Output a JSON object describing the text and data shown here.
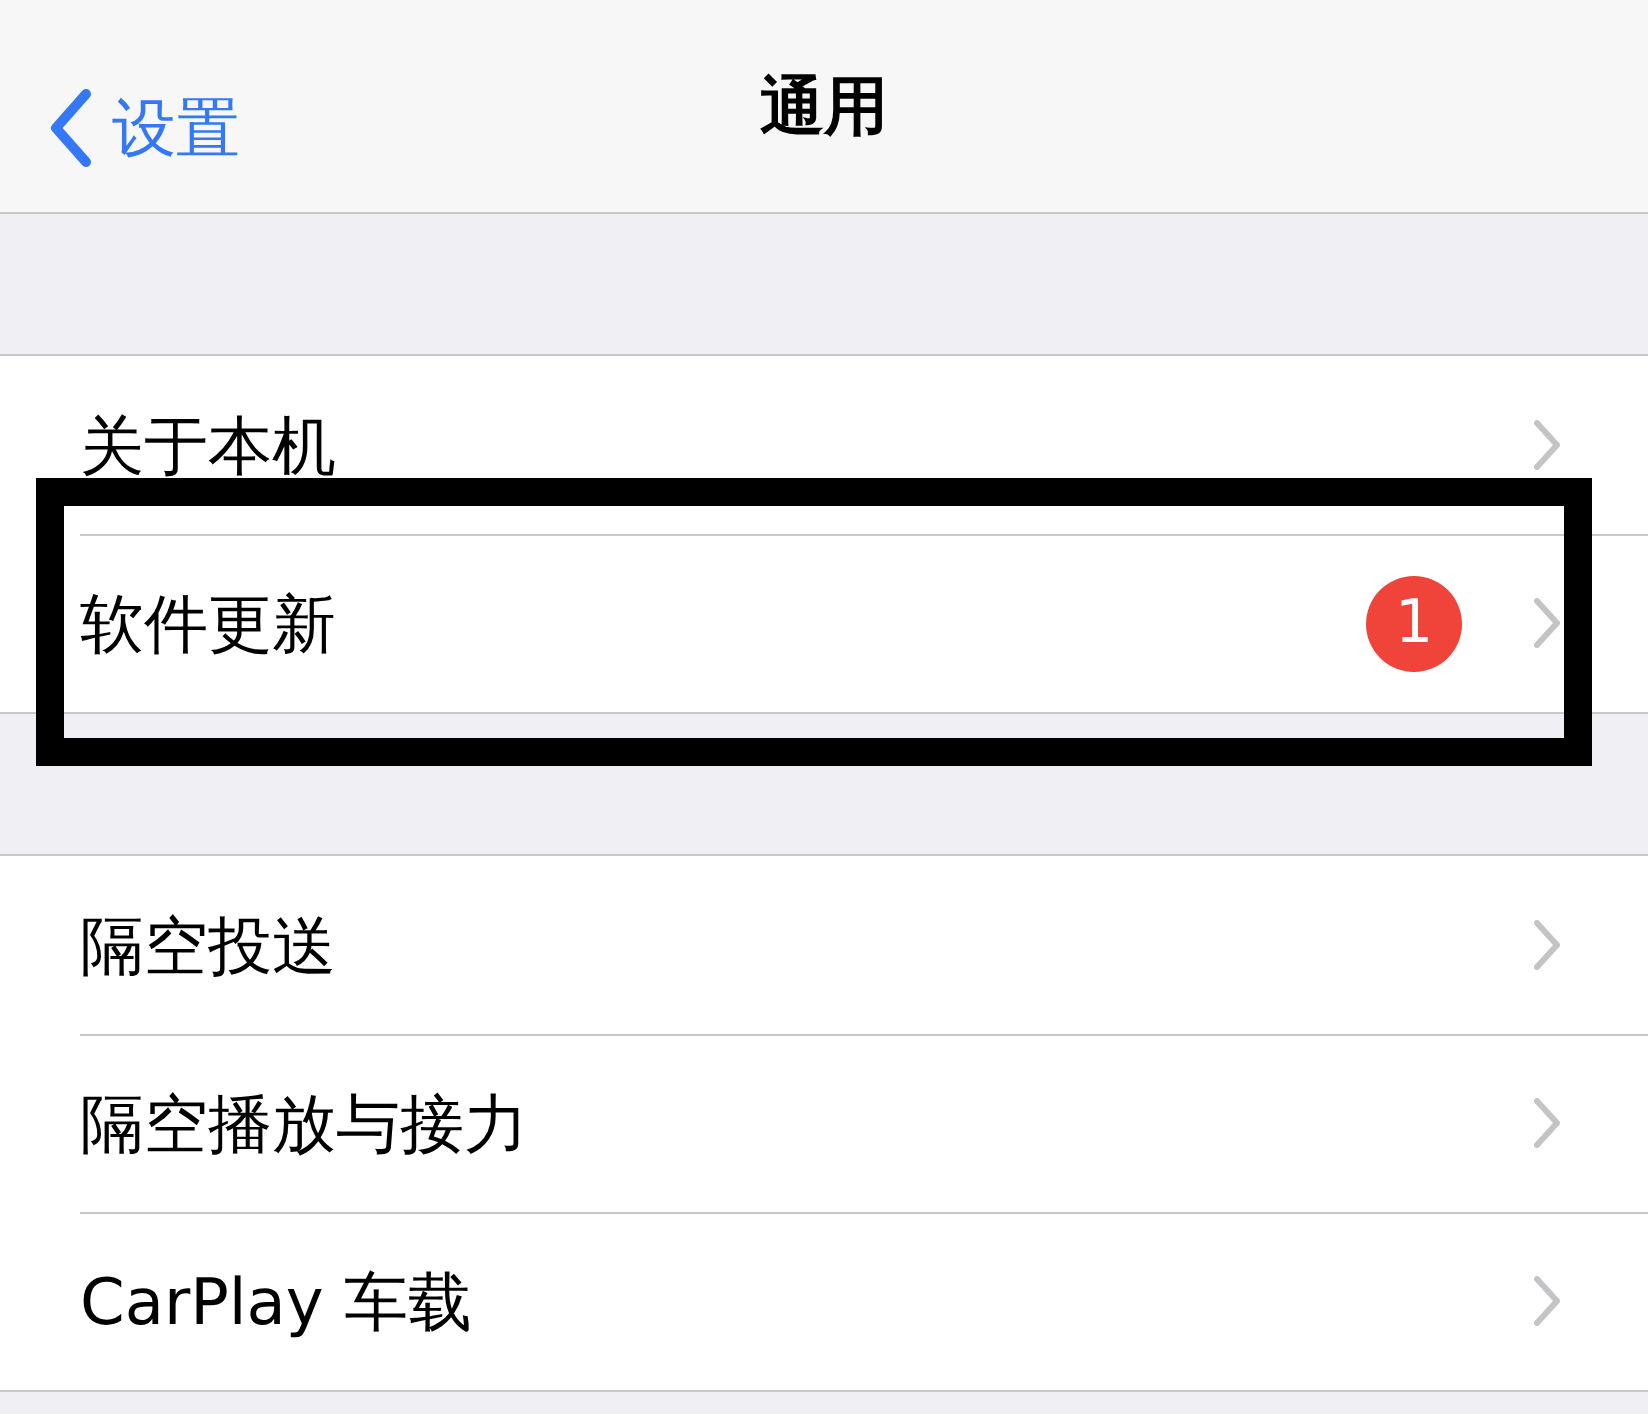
{
  "nav": {
    "back_label": "设置",
    "title": "通用"
  },
  "sections": [
    {
      "items": [
        {
          "label": "关于本机",
          "highlighted": false
        },
        {
          "label": "软件更新",
          "badge": "1",
          "highlighted": true
        }
      ]
    },
    {
      "items": [
        {
          "label": "隔空投送",
          "highlighted": false
        },
        {
          "label": "隔空播放与接力",
          "highlighted": false
        },
        {
          "label": "CarPlay 车载",
          "highlighted": false
        }
      ]
    }
  ]
}
